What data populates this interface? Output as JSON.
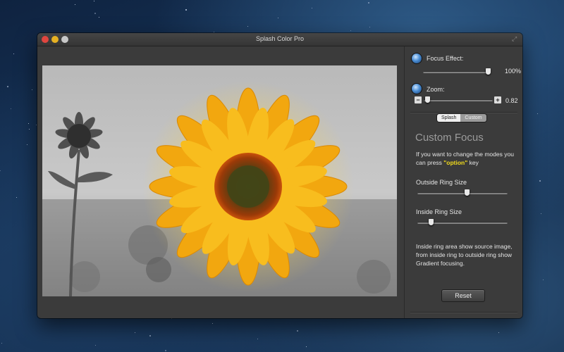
{
  "window": {
    "title": "Splash Color Pro"
  },
  "photo": {
    "subject": "sunflower"
  },
  "sidebar": {
    "focus_effect": {
      "label": "Focus Effect:",
      "value": "100%",
      "level": 1.0,
      "icon": "focus-icon"
    },
    "zoom": {
      "label": "Zoom:",
      "value": "0.82",
      "level": 0.02,
      "icon": "magnifier-icon",
      "minus": "−",
      "plus": "+"
    },
    "mode_tabs": [
      {
        "label": "Splash",
        "selected": true
      },
      {
        "label": "Custom",
        "selected": false
      }
    ],
    "heading": "Custom Focus",
    "hint": {
      "before": "If you want to change the modes you can press ",
      "highlight": "\"option\"",
      "after": " key"
    },
    "outside_ring": {
      "label": "Outside Ring Size",
      "level": 0.55
    },
    "inside_ring": {
      "label": "Inside Ring Size",
      "level": 0.13
    },
    "description": "Inside ring area show source image, from inside ring to outside ring show Gradient focusing.",
    "reset_label": "Reset"
  },
  "colors": {
    "accent_yellow": "#f2dc1c",
    "panel": "#3b3b3b"
  }
}
